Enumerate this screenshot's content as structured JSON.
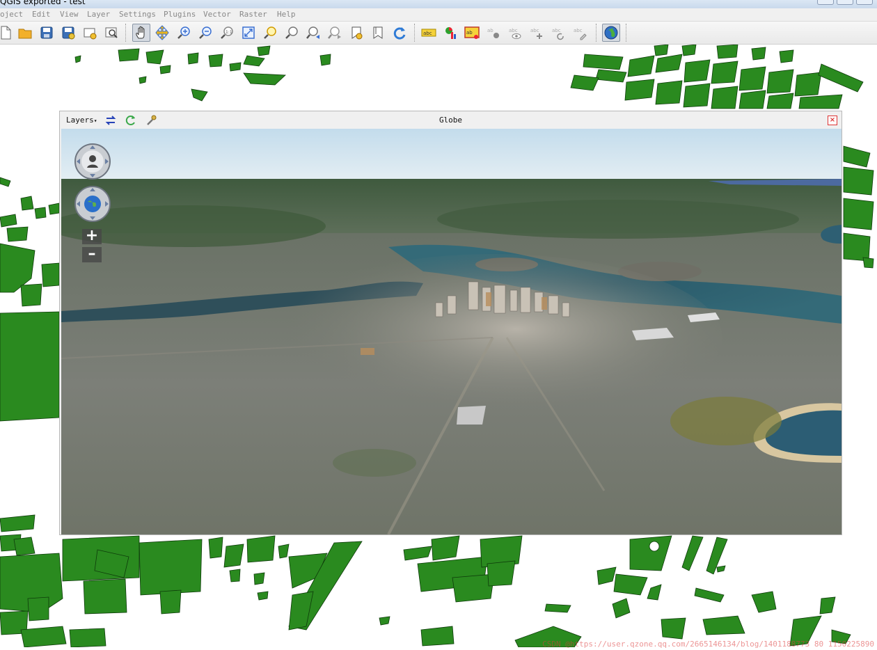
{
  "window": {
    "title": "QGIS exported - test"
  },
  "menu": [
    "oject",
    "Edit",
    "View",
    "Layer",
    "Settings",
    "Plugins",
    "Vector",
    "Raster",
    "Help"
  ],
  "toolbar": {
    "icons": [
      "new-project-icon",
      "open-project-icon",
      "save-project-icon",
      "save-as-icon",
      "new-print-composer-icon",
      "composer-manager-icon",
      "pan-icon",
      "pan-to-selection-icon",
      "zoom-in-icon",
      "zoom-out-icon",
      "zoom-actual-icon",
      "zoom-full-icon",
      "zoom-selection-icon",
      "zoom-layer-icon",
      "zoom-last-icon",
      "zoom-next-icon",
      "new-bookmark-icon",
      "show-bookmarks-icon",
      "refresh-icon"
    ],
    "label_icons": [
      "label-toolbar-icon",
      "layer-diagram-icon",
      "label-highlight-icon",
      "pin-labels-icon",
      "show-hide-labels-icon",
      "move-label-icon",
      "rotate-label-icon",
      "change-label-icon"
    ],
    "globe_icon": "globe-launch-icon"
  },
  "globe": {
    "layers_label": "Layers",
    "title": "Globe",
    "controls": {
      "zoom_in": "+",
      "zoom_out": "–"
    }
  },
  "watermark": "CSDN @https://user.qzone.qq.com/2665146134/blog/1401188773 80 1150225890"
}
